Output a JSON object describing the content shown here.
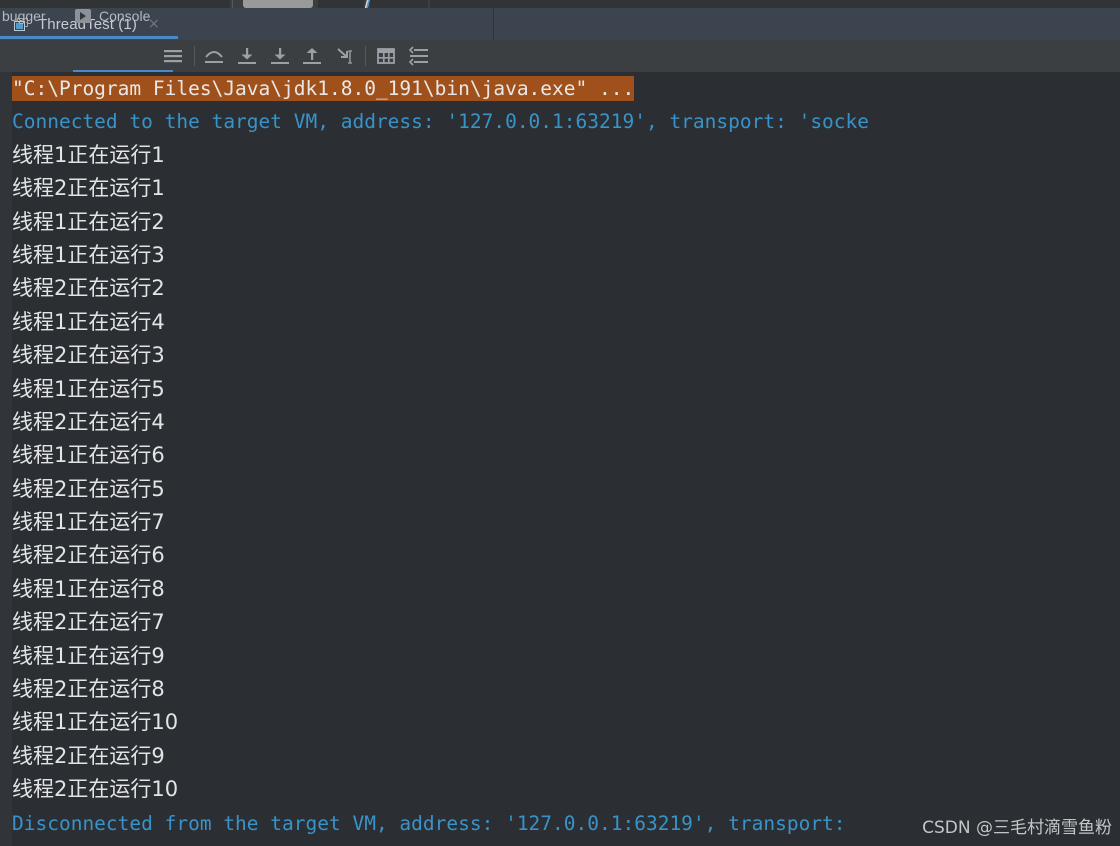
{
  "window": {
    "background_color": "#2b2f33"
  },
  "top_strip": {
    "name": "partial-toolbar-strip"
  },
  "tabbar": {
    "background_color": "#3c4450",
    "accent_color": "#4a88c7",
    "tabs": [
      {
        "label": "ThreadTest (1)",
        "icon": "console-window-icon",
        "close_label": "×",
        "active": true
      }
    ]
  },
  "toolbar": {
    "background_color": "#3c3f41",
    "debugger_tab_label": "bugger",
    "console_tab_label": "Console",
    "console_tab_icon": "run-play-icon",
    "buttons": [
      {
        "name": "show-console-lines-icon",
        "title": "Soft-Wrap / Lines"
      },
      {
        "name": "step-over-icon",
        "title": "Step Over"
      },
      {
        "name": "step-into-icon",
        "title": "Step Into"
      },
      {
        "name": "force-step-into-icon",
        "title": "Force Step Into"
      },
      {
        "name": "step-out-icon",
        "title": "Step Out"
      },
      {
        "name": "run-to-cursor-icon",
        "title": "Run to Cursor"
      },
      {
        "name": "evaluate-expression-icon",
        "title": "Evaluate Expression"
      },
      {
        "name": "mute-breakpoints-icon",
        "title": "Threads View"
      }
    ]
  },
  "console": {
    "background_color": "#2b2f33",
    "gutter_color": "#313438",
    "command_highlight_color": "#a0501a",
    "system_text_color": "#3993c8",
    "output_text_color": "#e2e4e6",
    "lines": [
      {
        "kind": "cmd",
        "text": "\"C:\\Program Files\\Java\\jdk1.8.0_191\\bin\\java.exe\" ..."
      },
      {
        "kind": "sys",
        "text": "Connected to the target VM, address: '127.0.0.1:63219', transport: 'socke"
      },
      {
        "kind": "out",
        "text": "线程1正在运行1"
      },
      {
        "kind": "out",
        "text": "线程2正在运行1"
      },
      {
        "kind": "out",
        "text": "线程1正在运行2"
      },
      {
        "kind": "out",
        "text": "线程1正在运行3"
      },
      {
        "kind": "out",
        "text": "线程2正在运行2"
      },
      {
        "kind": "out",
        "text": "线程1正在运行4"
      },
      {
        "kind": "out",
        "text": "线程2正在运行3"
      },
      {
        "kind": "out",
        "text": "线程1正在运行5"
      },
      {
        "kind": "out",
        "text": "线程2正在运行4"
      },
      {
        "kind": "out",
        "text": "线程1正在运行6"
      },
      {
        "kind": "out",
        "text": "线程2正在运行5"
      },
      {
        "kind": "out",
        "text": "线程1正在运行7"
      },
      {
        "kind": "out",
        "text": "线程2正在运行6"
      },
      {
        "kind": "out",
        "text": "线程1正在运行8"
      },
      {
        "kind": "out",
        "text": "线程2正在运行7"
      },
      {
        "kind": "out",
        "text": "线程1正在运行9"
      },
      {
        "kind": "out",
        "text": "线程2正在运行8"
      },
      {
        "kind": "out",
        "text": "线程1正在运行10"
      },
      {
        "kind": "out",
        "text": "线程2正在运行9"
      },
      {
        "kind": "out",
        "text": "线程2正在运行10"
      },
      {
        "kind": "sys",
        "text": "Disconnected from the target VM, address: '127.0.0.1:63219', transport:"
      }
    ]
  },
  "watermark": {
    "text": "CSDN @三毛村滴雪鱼粉"
  }
}
